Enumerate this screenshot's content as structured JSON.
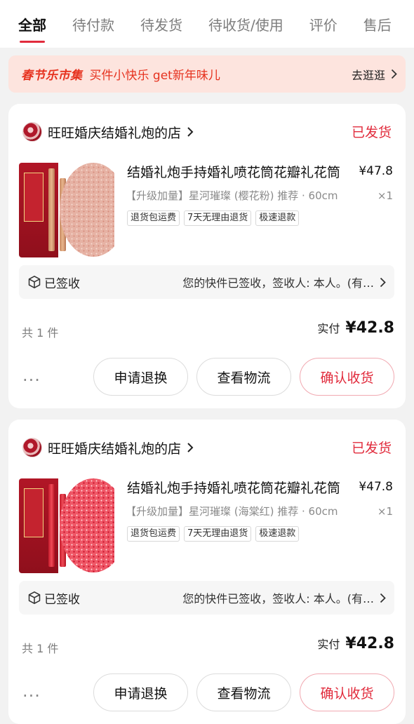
{
  "tabs": [
    {
      "label": "全部",
      "active": true
    },
    {
      "label": "待付款"
    },
    {
      "label": "待发货"
    },
    {
      "label": "待收货/使用"
    },
    {
      "label": "评价"
    },
    {
      "label": "售后"
    }
  ],
  "banner": {
    "brand": "春节乐市集",
    "text": "买件小快乐 get新年味儿",
    "link": "去逛逛"
  },
  "orders": [
    {
      "shop": "旺旺婚庆结婚礼炮的店",
      "status": "已发货",
      "product_title": "结婚礼炮手持婚礼喷花筒花瓣礼花筒",
      "price": "¥47.8",
      "sku": "【升级加量】星河璀璨 (樱花粉) 推荐 · 60cm",
      "qty": "×1",
      "tags": [
        "退货包运费",
        "7天无理由退货",
        "极速退款"
      ],
      "logistics_status": "已签收",
      "logistics_msg": "您的快件已签收，签收人: 本人。(有…",
      "count": "共 1 件",
      "total_label": "实付",
      "total_value": "¥42.8",
      "buttons": {
        "refund": "申请退换",
        "track": "查看物流",
        "confirm": "确认收货"
      },
      "image_text": {
        "title": "星河璀璨",
        "upgrade": "升级加量"
      }
    },
    {
      "shop": "旺旺婚庆结婚礼炮的店",
      "status": "已发货",
      "product_title": "结婚礼炮手持婚礼喷花筒花瓣礼花筒",
      "price": "¥47.8",
      "sku": "【升级加量】星河璀璨 (海棠红) 推荐 · 60cm",
      "qty": "×1",
      "tags": [
        "退货包运费",
        "7天无理由退货",
        "极速退款"
      ],
      "logistics_status": "已签收",
      "logistics_msg": "您的快件已签收，签收人: 本人。(有…",
      "count": "共 1 件",
      "total_label": "实付",
      "total_value": "¥42.8",
      "buttons": {
        "refund": "申请退换",
        "track": "查看物流",
        "confirm": "确认收货"
      },
      "image_text": {
        "title": "星河璀璨",
        "upgrade": "升级加量"
      }
    }
  ],
  "colors": {
    "accent": "#e12b3c",
    "banner_bg": "#fde4de",
    "page_bg": "#f2f2f2"
  },
  "icons": [
    "chevron-right-icon",
    "package-icon",
    "more-dots-icon"
  ]
}
